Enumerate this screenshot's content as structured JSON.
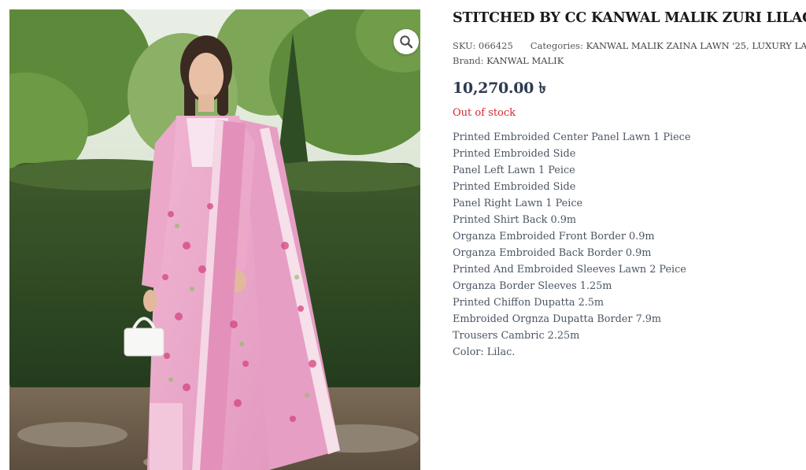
{
  "product": {
    "title": "STITCHED BY CC KANWAL MALIK ZURI LILAC",
    "sku_label": "SKU:",
    "sku": "066425",
    "categories_label": "Categories:",
    "category_1": "KANWAL MALIK ZAINA LAWN '25",
    "category_sep": ", ",
    "category_2": "LUXURY LAWN",
    "brand_label": "Brand:",
    "brand": "KANWAL MALIK",
    "price": "10,270.00 ৳",
    "stock_status": "Out of stock",
    "description": [
      "Printed Embroided Center Panel Lawn 1 Piece",
      "Printed Embroided Side",
      "Panel Left Lawn 1 Peice",
      "Printed Embroided Side",
      "Panel Right Lawn 1 Peice",
      "Printed Shirt Back 0.9m",
      "Organza Embroided Front Border 0.9m",
      "Organza Embroided Back Border 0.9m",
      "Printed And Embroided Sleeves Lawn 2 Peice",
      "Organza Border Sleeves 1.25m",
      "Printed Chiffon Dupatta 2.5m",
      "Embroided Orgnza Dupatta Border 7.9m",
      "Trousers Cambric 2.25m",
      "Color: Lilac."
    ]
  },
  "gallery": {
    "zoom_icon": "magnifier-icon"
  },
  "colors": {
    "title": "#1a1a1a",
    "price": "#2b3a4f",
    "out_of_stock": "#d8262e",
    "dress_pink": "#e6a2c4"
  }
}
